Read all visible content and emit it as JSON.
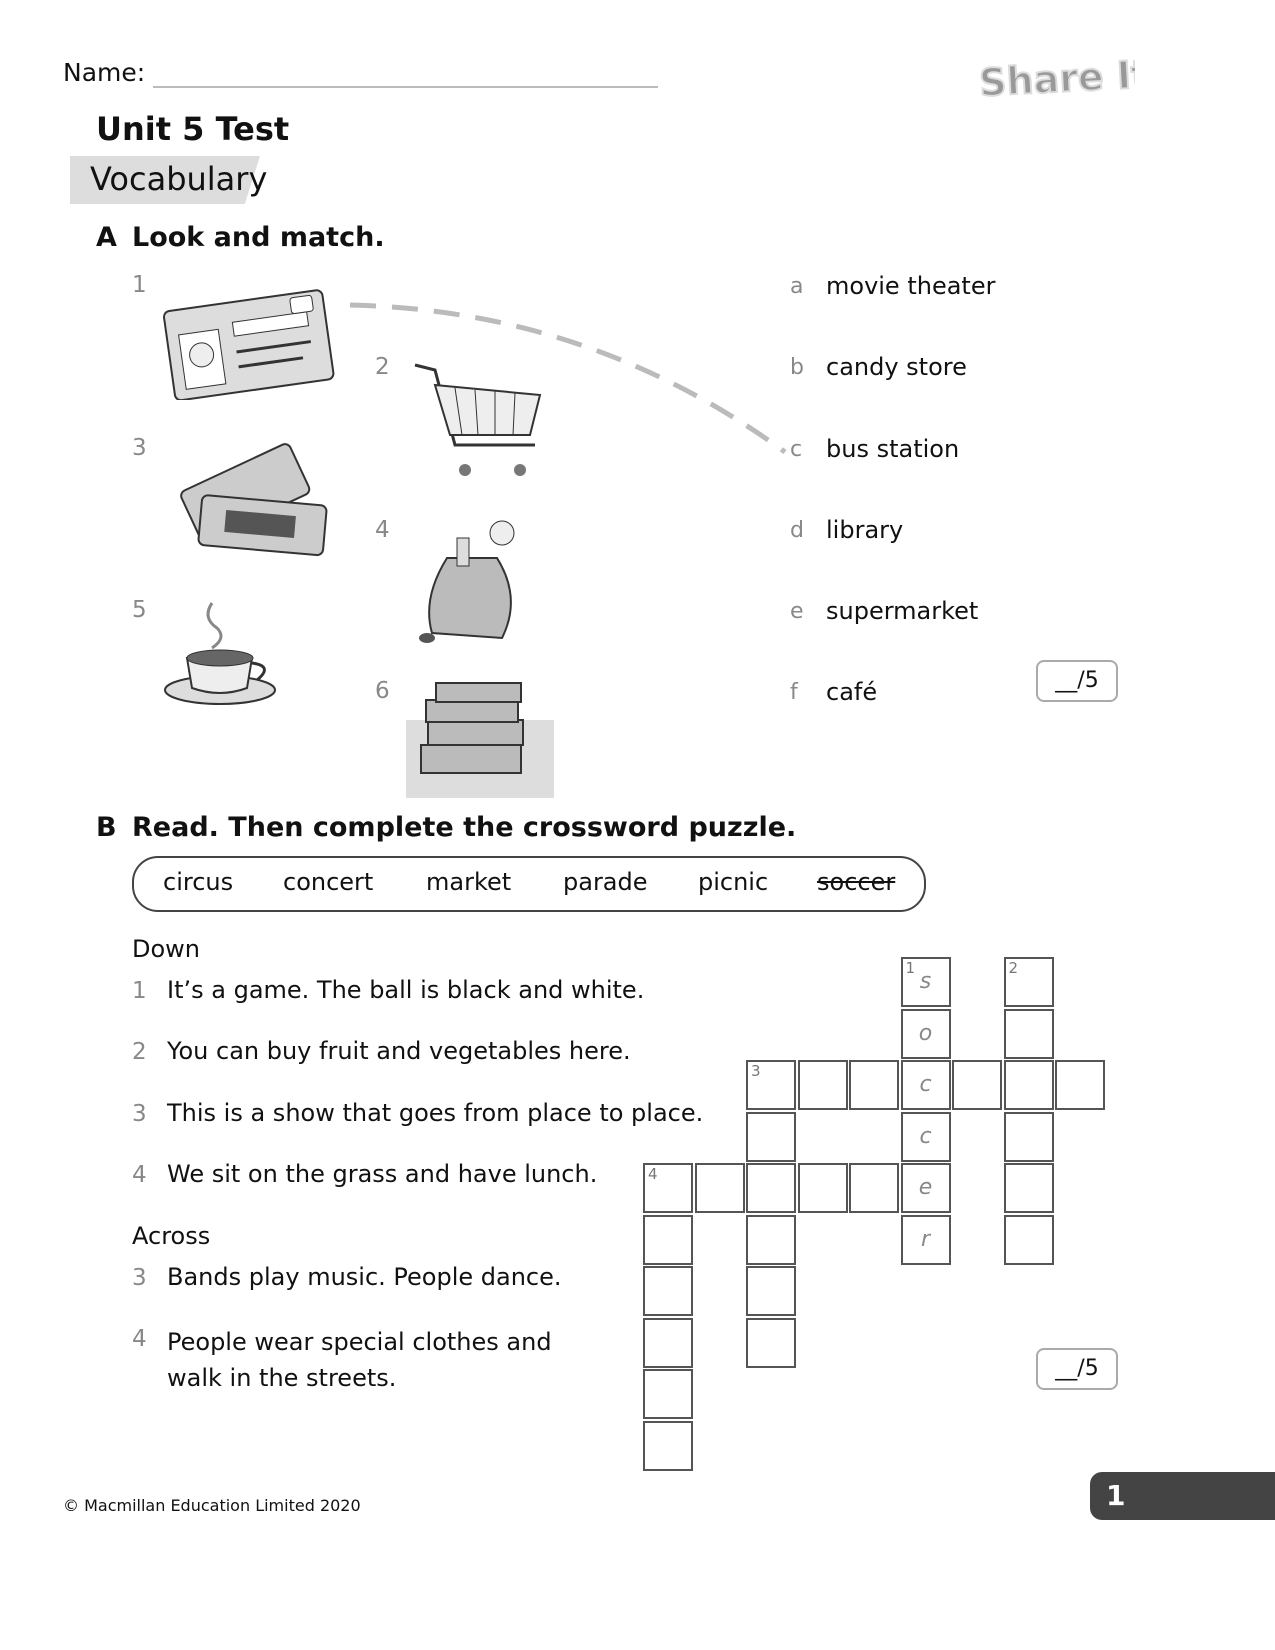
{
  "header": {
    "name_label": "Name:",
    "logo_text": "Share It!",
    "title": "Unit 5 Test",
    "section": "Vocabulary"
  },
  "part_a": {
    "heading_letter": "A",
    "heading": "Look and match.",
    "pictures": [
      {
        "num": "1",
        "icon": "bus-pass-card"
      },
      {
        "num": "2",
        "icon": "shopping-cart"
      },
      {
        "num": "3",
        "icon": "movie-tickets"
      },
      {
        "num": "4",
        "icon": "candy-bag"
      },
      {
        "num": "5",
        "icon": "coffee-cup"
      },
      {
        "num": "6",
        "icon": "stack-of-books"
      }
    ],
    "options": [
      {
        "letter": "a",
        "word": "movie theater"
      },
      {
        "letter": "b",
        "word": "candy store"
      },
      {
        "letter": "c",
        "word": "bus station"
      },
      {
        "letter": "d",
        "word": "library"
      },
      {
        "letter": "e",
        "word": "supermarket"
      },
      {
        "letter": "f",
        "word": "café"
      }
    ],
    "example_match": "1-c",
    "score": "__/5"
  },
  "part_b": {
    "heading_letter": "B",
    "heading": "Read. Then complete the crossword puzzle.",
    "words": [
      "circus",
      "concert",
      "market",
      "parade",
      "picnic",
      "soccer"
    ],
    "crossed_word": "soccer",
    "down_label": "Down",
    "down": [
      {
        "num": "1",
        "text": "It’s a game. The ball is black and white."
      },
      {
        "num": "2",
        "text": "You can buy fruit and vegetables here."
      },
      {
        "num": "3",
        "text": "This is a show that goes from place to place."
      },
      {
        "num": "4",
        "text": "We sit on the grass and have lunch."
      }
    ],
    "across_label": "Across",
    "across": [
      {
        "num": "3",
        "text": "Bands play music. People dance."
      },
      {
        "num": "4",
        "text": "People wear special clothes and walk in the streets."
      }
    ],
    "filled_answer": [
      "s",
      "o",
      "c",
      "c",
      "e",
      "r"
    ],
    "grid_numbers": [
      "1",
      "2",
      "3",
      "4"
    ],
    "score": "__/5"
  },
  "footer": {
    "copyright": "© Macmillan Education Limited 2020",
    "page": "1"
  }
}
